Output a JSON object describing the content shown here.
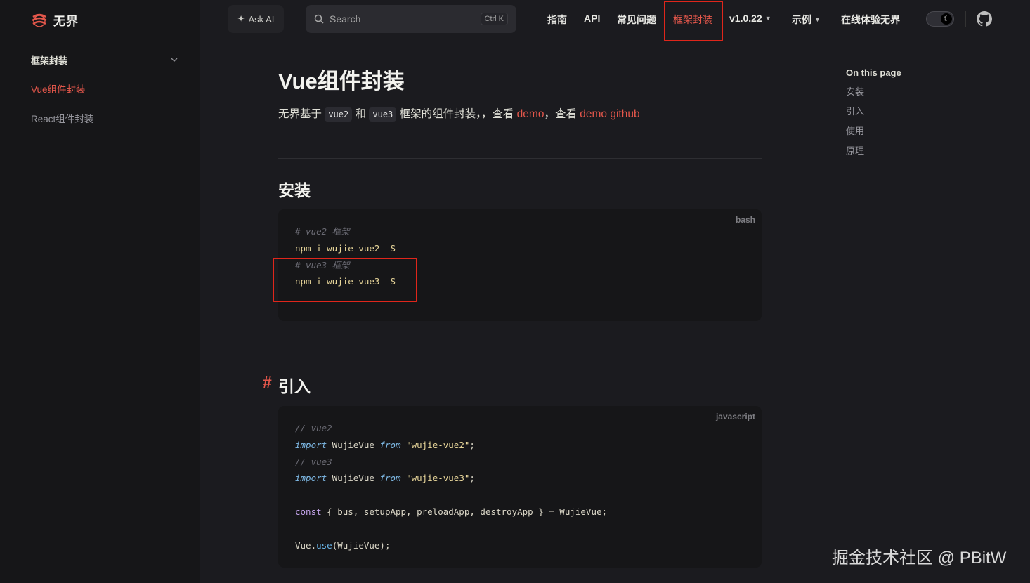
{
  "sidebar": {
    "logo_text": "无界",
    "group_title": "框架封装",
    "items": [
      {
        "label": "Vue组件封装",
        "active": true
      },
      {
        "label": "React组件封装",
        "active": false
      }
    ]
  },
  "nav": {
    "ask_ai": "Ask AI",
    "search_placeholder": "Search",
    "search_shortcut": "Ctrl K",
    "items": [
      "指南",
      "API",
      "常见问题",
      "框架封装",
      "v1.0.22",
      "示例",
      "在线体验无界"
    ]
  },
  "main": {
    "title": "Vue组件封装",
    "intro": {
      "prefix": "无界基于",
      "code1": "vue2",
      "mid1": "和",
      "code2": "vue3",
      "mid2": "框架的组件封装，，查看",
      "link1": "demo",
      "mid3": "，查看",
      "link2": "demo github"
    },
    "section_install": {
      "heading": "安装",
      "lang": "bash",
      "lines": [
        "# vue2 框架",
        "npm i wujie-vue2 -S",
        "# vue3 框架",
        "npm i wujie-vue3 -S"
      ]
    },
    "section_import": {
      "hash": "#",
      "heading": "引入",
      "lang": "javascript",
      "lines": [
        "// vue2",
        "import WujieVue from \"wujie-vue2\";",
        "// vue3",
        "import WujieVue from \"wujie-vue3\";",
        "",
        "const { bus, setupApp, preloadApp, destroyApp } = WujieVue;",
        "",
        "Vue.use(WujieVue);"
      ]
    }
  },
  "outline": {
    "title": "On this page",
    "items": [
      "安装",
      "引入",
      "使用",
      "原理"
    ]
  },
  "watermark": "掘金技术社区 @ PBitW",
  "colors": {
    "accent": "#e4574b",
    "annotation": "#e0261b",
    "background": "#1b1b1f"
  }
}
